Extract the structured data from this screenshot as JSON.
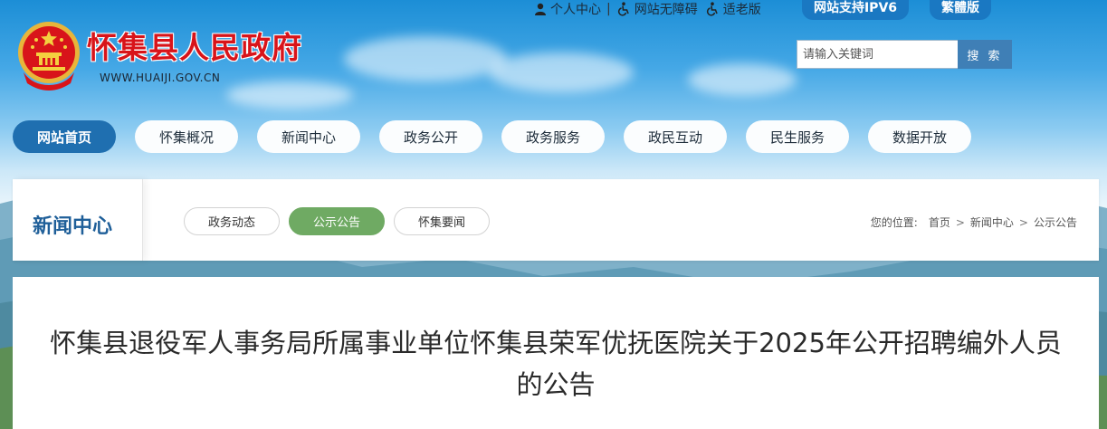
{
  "utility": {
    "personal_center": "个人中心",
    "accessibility": "网站无障碍",
    "elder_mode": "适老版",
    "ipv6": "网站支持IPV6",
    "traditional": "繁體版"
  },
  "logo": {
    "title": "怀集县人民政府",
    "url": "WWW.HUAIJI.GOV.CN"
  },
  "search": {
    "placeholder": "请输入关键词",
    "button": "搜 索"
  },
  "nav": {
    "items": [
      {
        "label": "网站首页",
        "active": true
      },
      {
        "label": "怀集概况"
      },
      {
        "label": "新闻中心"
      },
      {
        "label": "政务公开"
      },
      {
        "label": "政务服务"
      },
      {
        "label": "政民互动"
      },
      {
        "label": "民生服务"
      },
      {
        "label": "数据开放"
      }
    ]
  },
  "section": {
    "title": "新闻中心",
    "tabs": [
      {
        "label": "政务动态"
      },
      {
        "label": "公示公告",
        "active": true
      },
      {
        "label": "怀集要闻"
      }
    ],
    "breadcrumb": {
      "prefix": "您的位置:",
      "items": [
        "首页",
        "新闻中心",
        "公示公告"
      ],
      "separator": ">"
    }
  },
  "article": {
    "title": "怀集县退役军人事务局所属事业单位怀集县荣军优抚医院关于2025年公开招聘编外人员的公告"
  },
  "colors": {
    "nav_active": "#1f6fb0",
    "tab_active": "#6faa63",
    "title_red": "#d8141a",
    "section_blue": "#1f5f99"
  }
}
